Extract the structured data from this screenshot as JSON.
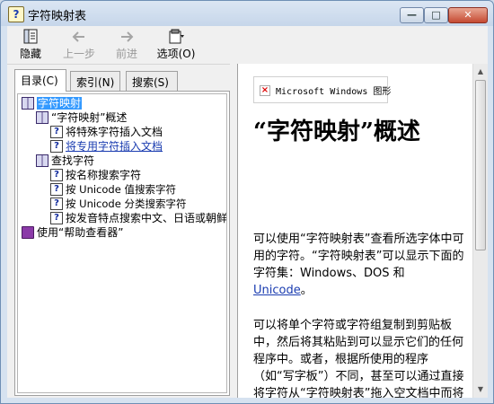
{
  "window": {
    "title": "字符映射表",
    "controls": {
      "minimize": "—",
      "maximize": "□",
      "close": "✕"
    }
  },
  "toolbar": {
    "hide": "隐藏",
    "back": "上一步",
    "forward": "前进",
    "options": "选项(O)"
  },
  "tabs": [
    "目录(C)",
    "索引(N)",
    "搜索(S)"
  ],
  "tree": [
    {
      "label": "字符映射",
      "icon": "open-book-icon",
      "level": 0,
      "selected": true
    },
    {
      "label": "“字符映射”概述",
      "icon": "open-book-icon",
      "level": 1
    },
    {
      "label": "将特殊字符插入文档",
      "icon": "help-page-icon",
      "level": 2
    },
    {
      "label": "将专用字符插入文档",
      "icon": "help-page-icon",
      "level": 2,
      "link": true
    },
    {
      "label": "查找字符",
      "icon": "open-book-icon",
      "level": 1
    },
    {
      "label": "按名称搜索字符",
      "icon": "help-page-icon",
      "level": 2
    },
    {
      "label": "按 Unicode 值搜索字符",
      "icon": "help-page-icon",
      "level": 2
    },
    {
      "label": "按 Unicode 分类搜索字符",
      "icon": "help-page-icon",
      "level": 2
    },
    {
      "label": "按发音特点搜索中文、日语或朝鲜",
      "icon": "help-page-icon",
      "level": 2
    },
    {
      "label": "使用“帮助查看器”",
      "icon": "closed-book-icon",
      "level": 0
    }
  ],
  "content": {
    "image_alt": "Microsoft Windows 图形",
    "heading": "“字符映射”概述",
    "para1_a": "可以使用“字符映射表”查看所选字体中可用的字符。“字符映射表”可以显示下面的字符集：Windows、DOS 和 ",
    "para1_link": "Unicode",
    "para1_b": "。",
    "para2": "可以将单个字符或字符组复制到剪贴板中，然后将其粘贴到可以显示它们的任何程序中。或者，根据所使用的程序（如“写字板”）不同，甚至可以通过直接将字符从“字符映射表”拖入空文档中而将其复制。"
  }
}
